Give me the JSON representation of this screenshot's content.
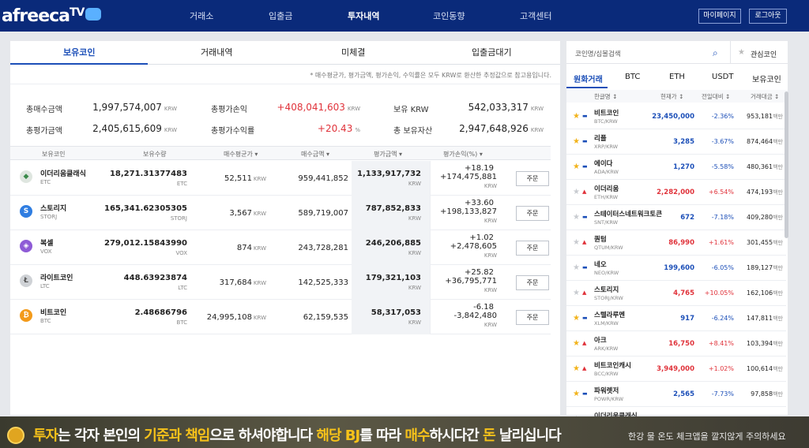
{
  "header": {
    "logo": "afreeca",
    "logo_tv": "TV",
    "nav": [
      "거래소",
      "입출금",
      "투자내역",
      "코인동향",
      "고객센터"
    ],
    "active_nav": "투자내역",
    "mypage": "마이페이지",
    "logout": "로그아웃"
  },
  "left": {
    "tabs": [
      "보유코인",
      "거래내역",
      "미체결",
      "입출금대기"
    ],
    "note": "* 매수평균가, 평가금액, 평가손익, 수익률은 모두 KRW로 환산한 추정값으로 참고용입니다.",
    "summary": {
      "buy_total_label": "총매수금액",
      "buy_total": "1,997,574,007",
      "eval_total_label": "총평가금액",
      "eval_total": "2,405,615,609",
      "pl_label": "총평가손익",
      "pl": "+408,041,603",
      "pl_rate_label": "총평가수익률",
      "pl_rate": "+20.43",
      "krw_label": "보유 KRW",
      "krw": "542,033,317",
      "assets_label": "총 보유자산",
      "assets": "2,947,648,926",
      "unit": "KRW",
      "pct": "%"
    },
    "columns": [
      "보유코인",
      "보유수량",
      "매수평균가 ▾",
      "매수금액 ▾",
      "평가금액 ▾",
      "평가손익(%) ▾"
    ],
    "rows": [
      {
        "name": "이더리움클래식",
        "sym": "ETC",
        "qty": "18,271.31377483",
        "avg": "52,511",
        "buy": "959,441,852",
        "eval": "1,133,917,732",
        "pct": "+18.19",
        "pl": "+174,475,881",
        "up": true
      },
      {
        "name": "스토리지",
        "sym": "STORJ",
        "qty": "165,341.62305305",
        "avg": "3,567",
        "buy": "589,719,007",
        "eval": "787,852,833",
        "pct": "+33.60",
        "pl": "+198,133,827",
        "up": true
      },
      {
        "name": "복셀",
        "sym": "VOX",
        "qty": "279,012.15843990",
        "avg": "874",
        "buy": "243,728,281",
        "eval": "246,206,885",
        "pct": "+1.02",
        "pl": "+2,478,605",
        "up": true
      },
      {
        "name": "라이트코인",
        "sym": "LTC",
        "qty": "448.63923874",
        "avg": "317,684",
        "buy": "142,525,333",
        "eval": "179,321,103",
        "pct": "+25.82",
        "pl": "+36,795,771",
        "up": true
      },
      {
        "name": "비트코인",
        "sym": "BTC",
        "qty": "2.48686796",
        "avg": "24,995,108",
        "buy": "62,159,535",
        "eval": "58,317,053",
        "pct": "-6.18",
        "pl": "-3,842,480",
        "up": false
      }
    ],
    "order_label": "주문",
    "krw": "KRW"
  },
  "right": {
    "search_placeholder": "코인명/심볼검색",
    "fav_label": "관심코인",
    "tabs": [
      "원화거래",
      "BTC",
      "ETH",
      "USDT",
      "보유코인"
    ],
    "columns": [
      "한글명 ↕",
      "현재가 ↕",
      "전일대비 ↕",
      "거래대금 ↕"
    ],
    "vol_unit": "백만",
    "rows": [
      {
        "name": "비트코인",
        "sym": "BTC/KRW",
        "price": "23,450,000",
        "chg": "-2.36%",
        "vol": "953,181",
        "up": false,
        "fav": true
      },
      {
        "name": "리플",
        "sym": "XRP/KRW",
        "price": "3,285",
        "chg": "-3.67%",
        "vol": "874,464",
        "up": false,
        "fav": true
      },
      {
        "name": "에이다",
        "sym": "ADA/KRW",
        "price": "1,270",
        "chg": "-5.58%",
        "vol": "480,361",
        "up": false,
        "fav": true
      },
      {
        "name": "이더리움",
        "sym": "ETH/KRW",
        "price": "2,282,000",
        "chg": "+6.54%",
        "vol": "474,193",
        "up": true,
        "fav": false
      },
      {
        "name": "스테이터스네트워크토큰",
        "sym": "SNT/KRW",
        "price": "672",
        "chg": "-7.18%",
        "vol": "409,280",
        "up": false,
        "fav": false
      },
      {
        "name": "퀀텀",
        "sym": "QTUM/KRW",
        "price": "86,990",
        "chg": "+1.61%",
        "vol": "301,455",
        "up": true,
        "fav": false
      },
      {
        "name": "네오",
        "sym": "NEO/KRW",
        "price": "199,600",
        "chg": "-6.05%",
        "vol": "189,127",
        "up": false,
        "fav": false
      },
      {
        "name": "스토리지",
        "sym": "STORJ/KRW",
        "price": "4,765",
        "chg": "+10.05%",
        "vol": "162,106",
        "up": true,
        "fav": false
      },
      {
        "name": "스텔라루멘",
        "sym": "XLM/KRW",
        "price": "917",
        "chg": "-6.24%",
        "vol": "147,811",
        "up": false,
        "fav": true
      },
      {
        "name": "아크",
        "sym": "ARK/KRW",
        "price": "16,750",
        "chg": "+8.41%",
        "vol": "103,394",
        "up": true,
        "fav": true
      },
      {
        "name": "비트코인캐시",
        "sym": "BCC/KRW",
        "price": "3,949,000",
        "chg": "+1.02%",
        "vol": "100,614",
        "up": true,
        "fav": true
      },
      {
        "name": "파워렛저",
        "sym": "POWR/KRW",
        "price": "2,565",
        "chg": "-7.73%",
        "vol": "97,858",
        "up": false,
        "fav": true
      },
      {
        "name": "이더리움클래식",
        "sym": "",
        "price": "",
        "chg": "",
        "vol": "",
        "up": true,
        "fav": false
      }
    ]
  },
  "caption": {
    "p1": "투자",
    "p2": "는 각자 본인의 ",
    "p3": "기준과 책임",
    "p4": "으로 하셔야합니다 ",
    "p5": "해당 BJ",
    "p6": "를 따라 ",
    "p7": "매수",
    "p8": "하시다간 ",
    "p9": "돈",
    "p10": " 날리십니다",
    "small": "한강 물 온도 체크앱을 깔지않게 주의하세요"
  },
  "colors": {
    "up": "#e0323a",
    "down": "#1c4fb8",
    "brand": "#0a2a7a"
  }
}
